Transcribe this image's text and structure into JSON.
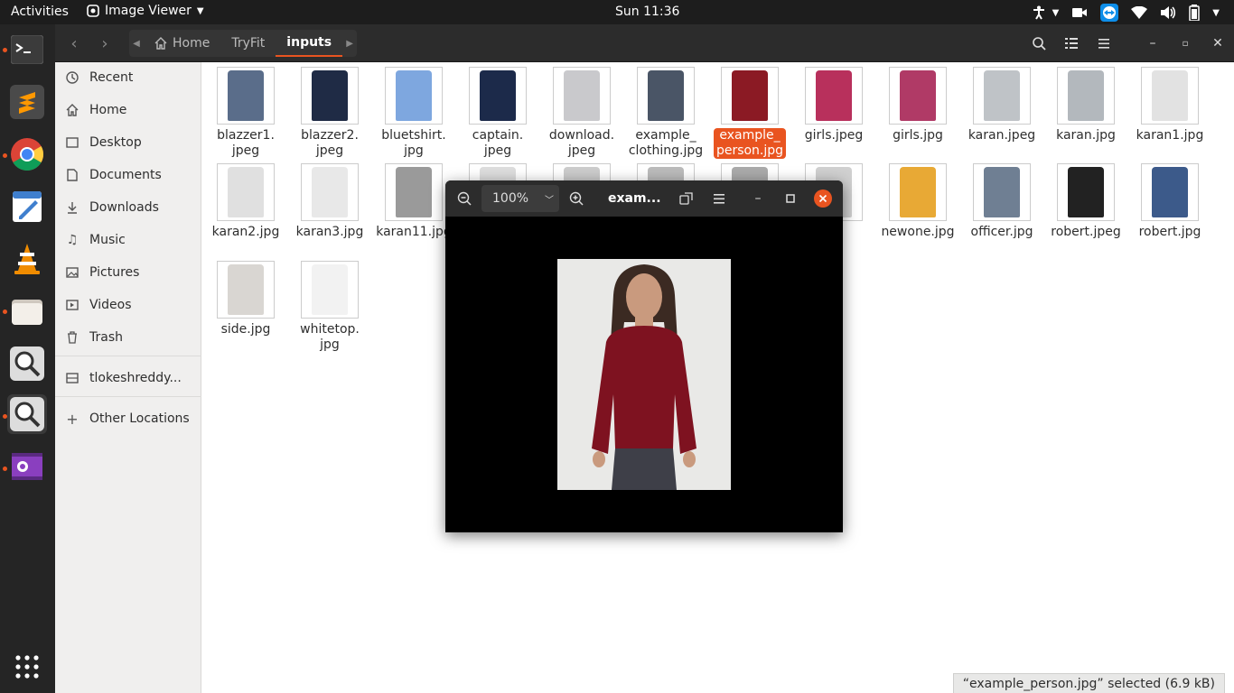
{
  "topbar": {
    "activities": "Activities",
    "app_name": "Image Viewer",
    "clock": "Sun 11:36"
  },
  "headerbar": {
    "path": [
      "Home",
      "TryFit",
      "inputs"
    ]
  },
  "sidebar": {
    "items": [
      {
        "label": "Recent",
        "icon": "clock-icon"
      },
      {
        "label": "Home",
        "icon": "home-icon"
      },
      {
        "label": "Desktop",
        "icon": "desktop-icon"
      },
      {
        "label": "Documents",
        "icon": "document-icon"
      },
      {
        "label": "Downloads",
        "icon": "download-icon"
      },
      {
        "label": "Music",
        "icon": "music-icon"
      },
      {
        "label": "Pictures",
        "icon": "pictures-icon"
      },
      {
        "label": "Videos",
        "icon": "videos-icon"
      },
      {
        "label": "Trash",
        "icon": "trash-icon"
      }
    ],
    "drive": "tlokeshreddy...",
    "other_locations": "Other Locations"
  },
  "files": [
    {
      "name": "blazzer1.\njpeg",
      "color": "#5a6d8a"
    },
    {
      "name": "blazzer2.\njpeg",
      "color": "#1f2b45"
    },
    {
      "name": "bluetshirt.\njpg",
      "color": "#7ea7df"
    },
    {
      "name": "captain.\njpeg",
      "color": "#1c2a4a"
    },
    {
      "name": "download.\njpeg",
      "color": "#c9c9cc"
    },
    {
      "name": "example_\nclothing.jpg",
      "color": "#4a5566"
    },
    {
      "name": "example_\nperson.jpg",
      "color": "#8b1a24",
      "selected": true
    },
    {
      "name": "girls.jpeg",
      "color": "#b8305c"
    },
    {
      "name": "girls.jpg",
      "color": "#b03a66"
    },
    {
      "name": "karan.jpeg",
      "color": "#bfc3c7"
    },
    {
      "name": "karan.jpg",
      "color": "#b3b8bd"
    },
    {
      "name": "karan1.jpg",
      "color": "#e2e2e2"
    },
    {
      "name": "karan2.jpg",
      "color": "#e0e0e0"
    },
    {
      "name": "karan3.jpg",
      "color": "#e8e8e8"
    },
    {
      "name": "karan11.jpg",
      "color": "#9a9a9a"
    },
    {
      "name": "",
      "color": "#dddddd"
    },
    {
      "name": "",
      "color": "#cccccc"
    },
    {
      "name": "",
      "color": "#bbbbbb"
    },
    {
      "name": "",
      "color": "#aaaaaa"
    },
    {
      "name": "pg",
      "color": "#d0d0d0"
    },
    {
      "name": "newone.jpg",
      "color": "#e8a935"
    },
    {
      "name": "officer.jpg",
      "color": "#6f7f93"
    },
    {
      "name": "robert.jpeg",
      "color": "#222222"
    },
    {
      "name": "robert.jpg",
      "color": "#3c5a8a"
    },
    {
      "name": "side.jpg",
      "color": "#d9d6d2"
    },
    {
      "name": "whitetop.\njpg",
      "color": "#f2f2f2"
    }
  ],
  "status": "“example_person.jpg” selected  (6.9 kB)",
  "viewer": {
    "zoom": "100%",
    "title": "exam..."
  }
}
